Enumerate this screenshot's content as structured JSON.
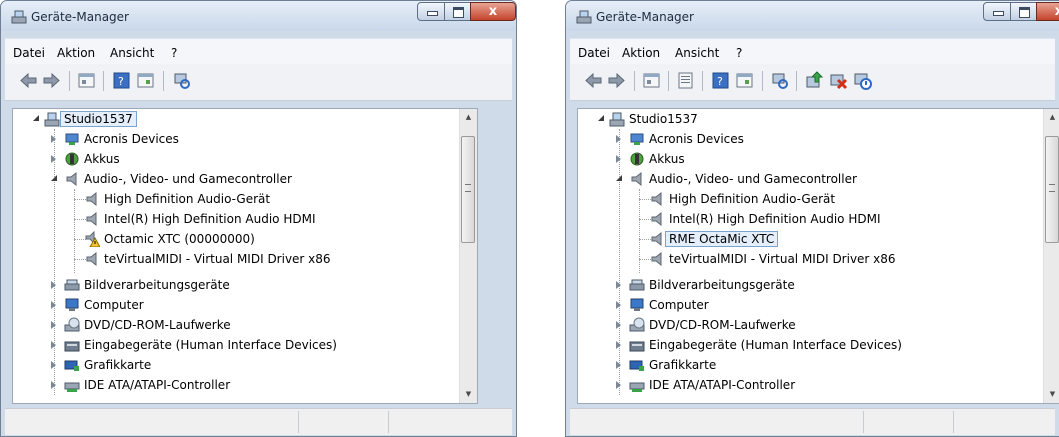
{
  "windows": [
    {
      "title": "Geräte-Manager",
      "menu": [
        "Datei",
        "Aktion",
        "Ansicht",
        "?"
      ],
      "tree": {
        "root": "Studio1537",
        "items": [
          {
            "label": "Acronis Devices",
            "icon": "acronis-device-icon"
          },
          {
            "label": "Akkus",
            "icon": "battery-icon"
          },
          {
            "label": "Audio-, Video- und Gamecontroller",
            "icon": "speaker-icon"
          },
          {
            "label": "High Definition Audio-Gerät",
            "icon": "speaker-icon"
          },
          {
            "label": "Intel(R) High Definition Audio HDMI",
            "icon": "speaker-icon"
          },
          {
            "label": "Octamic XTC (00000000)",
            "icon": "warning-speaker-icon"
          },
          {
            "label": "teVirtualMIDI - Virtual MIDI Driver x86",
            "icon": "speaker-icon"
          },
          {
            "label": "Bildverarbeitungsgeräte",
            "icon": "scanner-icon"
          },
          {
            "label": "Computer",
            "icon": "computer-icon"
          },
          {
            "label": "DVD/CD-ROM-Laufwerke",
            "icon": "disc-drive-icon"
          },
          {
            "label": "Eingabegeräte (Human Interface Devices)",
            "icon": "hid-icon"
          },
          {
            "label": "Grafikkarte",
            "icon": "display-adapter-icon"
          },
          {
            "label": "IDE ATA/ATAPI-Controller",
            "icon": "ide-controller-icon"
          }
        ]
      }
    },
    {
      "title": "Geräte-Manager",
      "menu": [
        "Datei",
        "Aktion",
        "Ansicht",
        "?"
      ],
      "tree": {
        "root": "Studio1537",
        "items": [
          {
            "label": "Acronis Devices",
            "icon": "acronis-device-icon"
          },
          {
            "label": "Akkus",
            "icon": "battery-icon"
          },
          {
            "label": "Audio-, Video- und Gamecontroller",
            "icon": "speaker-icon"
          },
          {
            "label": "High Definition Audio-Gerät",
            "icon": "speaker-icon"
          },
          {
            "label": "Intel(R) High Definition Audio HDMI",
            "icon": "speaker-icon"
          },
          {
            "label": "RME OctaMic XTC",
            "icon": "speaker-icon"
          },
          {
            "label": "teVirtualMIDI - Virtual MIDI Driver x86",
            "icon": "speaker-icon"
          },
          {
            "label": "Bildverarbeitungsgeräte",
            "icon": "scanner-icon"
          },
          {
            "label": "Computer",
            "icon": "computer-icon"
          },
          {
            "label": "DVD/CD-ROM-Laufwerke",
            "icon": "disc-drive-icon"
          },
          {
            "label": "Eingabegeräte (Human Interface Devices)",
            "icon": "hid-icon"
          },
          {
            "label": "Grafikkarte",
            "icon": "display-adapter-icon"
          },
          {
            "label": "IDE ATA/ATAPI-Controller",
            "icon": "ide-controller-icon"
          }
        ]
      }
    }
  ],
  "colors": {
    "window_frame": "#cfdbe9",
    "selection": "#e4effb",
    "close_button": "#c3442c"
  }
}
